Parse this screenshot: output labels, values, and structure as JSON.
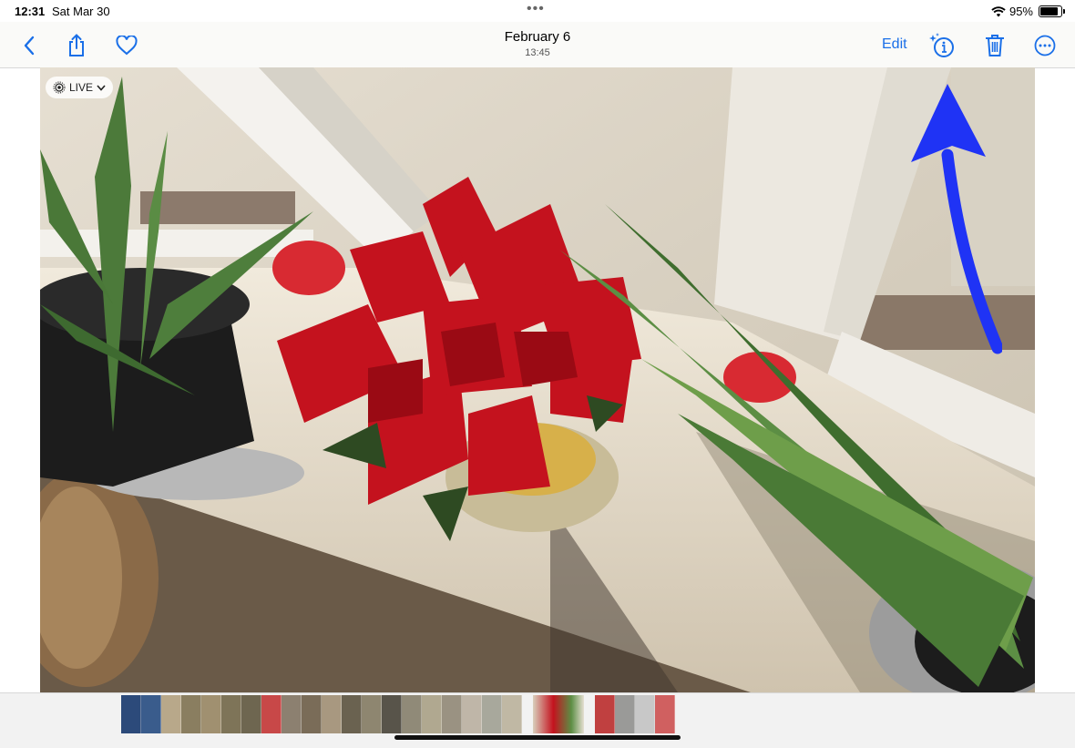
{
  "status_bar": {
    "time": "12:31",
    "date": "Sat Mar 30",
    "battery_text": "95%"
  },
  "nav": {
    "title": "February 6",
    "subtitle": "13:45",
    "edit_label": "Edit",
    "accent_color": "#1a6fe8"
  },
  "photo": {
    "live_label": "LIVE"
  },
  "annotation": {
    "arrow_color": "#1f33f5"
  },
  "thumbnails": [
    "#2c4a7a",
    "#3a5c8c",
    "#b8a88a",
    "#8a7e60",
    "#a09070",
    "#7e7458",
    "#6e6650",
    "#c84848",
    "#8c8070",
    "#7a6c58",
    "#a89880",
    "#6a6250",
    "#8e8670",
    "#58544a",
    "#908a78",
    "#b0a890",
    "#9a9282",
    "#bfb6a8",
    "#a8a89c",
    "#c0b8a4"
  ],
  "thumbnails_b": [
    "#c04040",
    "#9a9a98",
    "#c8c8c8",
    "#d06060"
  ]
}
